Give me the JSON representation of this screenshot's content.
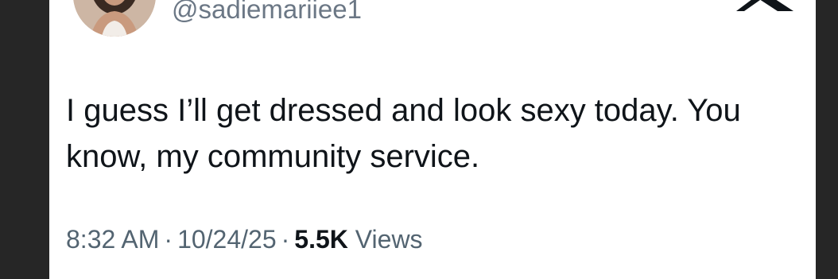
{
  "tweet": {
    "handle": "@sadiemariiee1",
    "text": "I guess I’ll get dressed and look sexy today. You know, my community service.",
    "time": "8:32 AM",
    "date": "10/24/25",
    "views_count": "5.5K",
    "views_label": "Views",
    "separator": "·"
  },
  "icons": {
    "logo": "x-logo-icon",
    "avatar": "profile-photo"
  },
  "colors": {
    "background": "#262626",
    "card": "#ffffff",
    "text": "#0f1419",
    "secondary_text": "#536471"
  }
}
